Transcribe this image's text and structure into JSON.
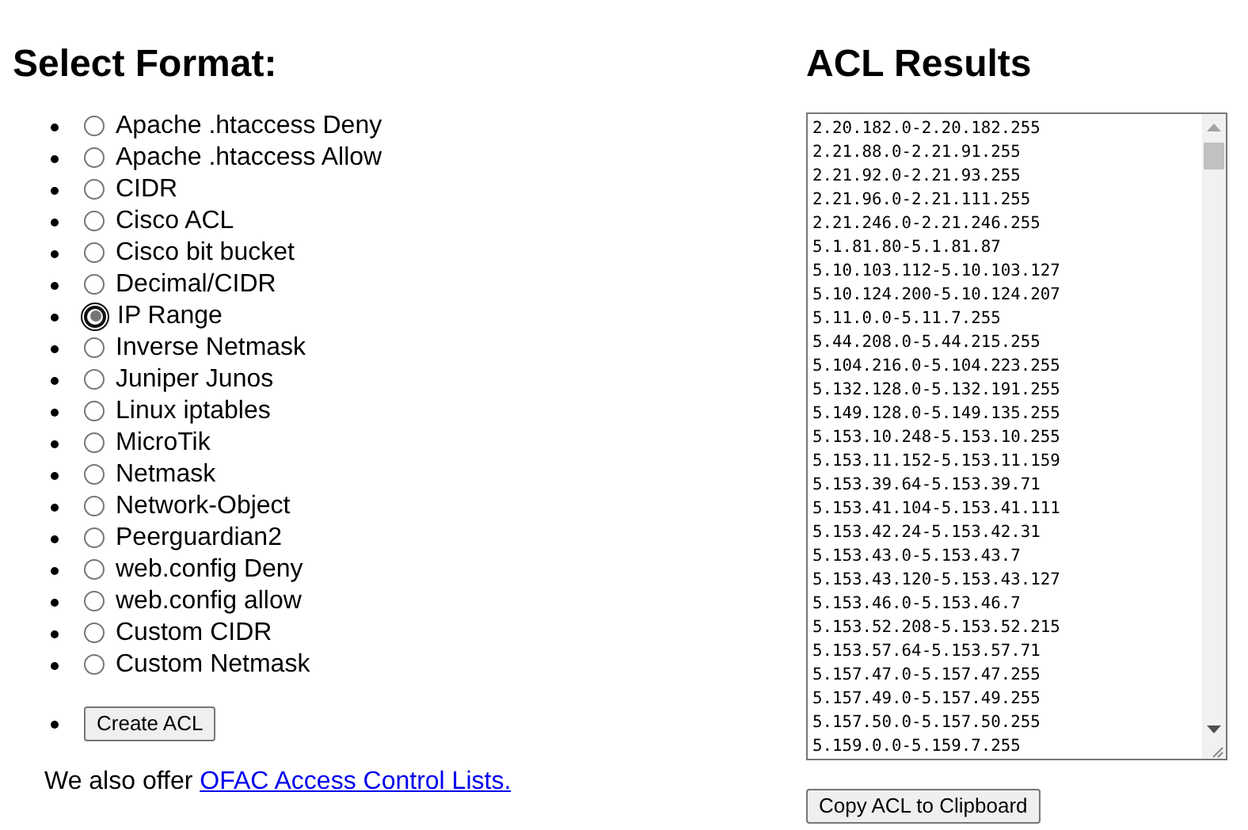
{
  "format_section": {
    "heading": "Select Format:",
    "options": [
      {
        "label": "Apache .htaccess Deny",
        "selected": false
      },
      {
        "label": "Apache .htaccess Allow",
        "selected": false
      },
      {
        "label": "CIDR",
        "selected": false
      },
      {
        "label": "Cisco ACL",
        "selected": false
      },
      {
        "label": "Cisco bit bucket",
        "selected": false
      },
      {
        "label": "Decimal/CIDR",
        "selected": false
      },
      {
        "label": "IP Range",
        "selected": true
      },
      {
        "label": "Inverse Netmask",
        "selected": false
      },
      {
        "label": "Juniper Junos",
        "selected": false
      },
      {
        "label": "Linux iptables",
        "selected": false
      },
      {
        "label": "MicroTik",
        "selected": false
      },
      {
        "label": "Netmask",
        "selected": false
      },
      {
        "label": "Network-Object",
        "selected": false
      },
      {
        "label": "Peerguardian2",
        "selected": false
      },
      {
        "label": "web.config Deny",
        "selected": false
      },
      {
        "label": "web.config allow",
        "selected": false
      },
      {
        "label": "Custom CIDR",
        "selected": false
      },
      {
        "label": "Custom Netmask",
        "selected": false
      }
    ],
    "create_button": "Create ACL",
    "footer_text": "We also offer ",
    "footer_link": "OFAC Access Control Lists."
  },
  "results_section": {
    "heading": "ACL Results",
    "lines": [
      "2.20.182.0-2.20.182.255",
      "2.21.88.0-2.21.91.255",
      "2.21.92.0-2.21.93.255",
      "2.21.96.0-2.21.111.255",
      "2.21.246.0-2.21.246.255",
      "5.1.81.80-5.1.81.87",
      "5.10.103.112-5.10.103.127",
      "5.10.124.200-5.10.124.207",
      "5.11.0.0-5.11.7.255",
      "5.44.208.0-5.44.215.255",
      "5.104.216.0-5.104.223.255",
      "5.132.128.0-5.132.191.255",
      "5.149.128.0-5.149.135.255",
      "5.153.10.248-5.153.10.255",
      "5.153.11.152-5.153.11.159",
      "5.153.39.64-5.153.39.71",
      "5.153.41.104-5.153.41.111",
      "5.153.42.24-5.153.42.31",
      "5.153.43.0-5.153.43.7",
      "5.153.43.120-5.153.43.127",
      "5.153.46.0-5.153.46.7",
      "5.153.52.208-5.153.52.215",
      "5.153.57.64-5.153.57.71",
      "5.157.47.0-5.157.47.255",
      "5.157.49.0-5.157.49.255",
      "5.157.50.0-5.157.50.255",
      "5.159.0.0-5.159.7.255"
    ],
    "copy_button": "Copy ACL to Clipboard"
  }
}
